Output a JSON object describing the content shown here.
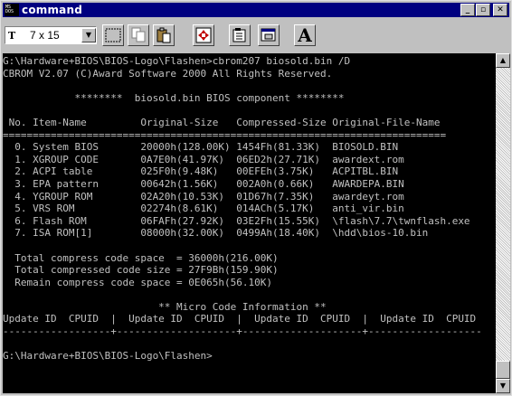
{
  "window": {
    "title": "command",
    "icon_text": [
      "MS",
      "DOS"
    ],
    "buttons": {
      "minimize": "_",
      "maximize": "▫",
      "close": "✕"
    }
  },
  "toolbar": {
    "font_prefix": "T",
    "font_size": "7 x 15",
    "dropdown_arrow": "▼",
    "tools": [
      "mark-icon",
      "copy-icon",
      "paste-icon",
      "fullscreen-icon",
      "properties-icon",
      "background-icon",
      "font-icon"
    ],
    "font_button_label": "A"
  },
  "terminal": {
    "lines": [
      "G:\\Hardware+BIOS\\BIOS-Logo\\Flashen>cbrom207 biosold.bin /D",
      "CBROM V2.07 (C)Award Software 2000 All Rights Reserved.",
      "",
      "            ********  biosold.bin BIOS component ********",
      "",
      " No. Item-Name         Original-Size   Compressed-Size Original-File-Name",
      "==========================================================================",
      "  0. System BIOS       20000h(128.00K) 1454Fh(81.33K)  BIOSOLD.BIN",
      "  1. XGROUP CODE       0A7E0h(41.97K)  06ED2h(27.71K)  awardext.rom",
      "  2. ACPI table        025F0h(9.48K)   00EFEh(3.75K)   ACPITBL.BIN",
      "  3. EPA pattern       00642h(1.56K)   002A0h(0.66K)   AWARDEPA.BIN",
      "  4. YGROUP ROM        02A20h(10.53K)  01D67h(7.35K)   awardeyt.rom",
      "  5. VRS ROM           02274h(8.61K)   014ACh(5.17K)   anti_vir.bin",
      "  6. Flash ROM         06FAFh(27.92K)  03E2Fh(15.55K)  \\flash\\7.7\\twnflash.exe",
      "  7. ISA ROM[1]        08000h(32.00K)  0499Ah(18.40K)  \\hdd\\bios-10.bin",
      "",
      "  Total compress code space  = 36000h(216.00K)",
      "  Total compressed code size = 27F9Bh(159.90K)",
      "  Remain compress code space = 0E065h(56.10K)",
      "",
      "                          ** Micro Code Information **",
      "Update ID  CPUID  |  Update ID  CPUID  |  Update ID  CPUID  |  Update ID  CPUID",
      "------------------+--------------------+--------------------+-------------------",
      "",
      "G:\\Hardware+BIOS\\BIOS-Logo\\Flashen>"
    ]
  },
  "scrollbar": {
    "up": "▲",
    "down": "▼"
  }
}
